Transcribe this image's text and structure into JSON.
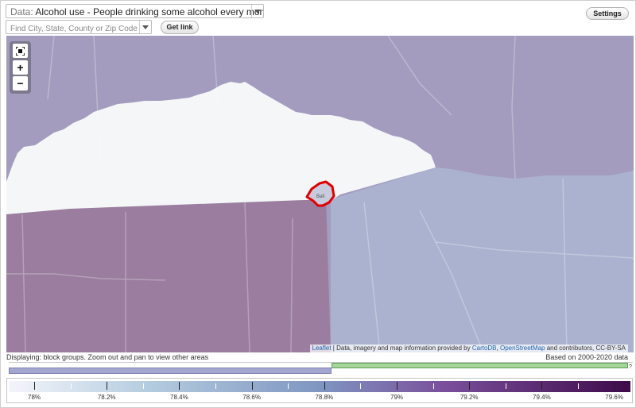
{
  "header": {
    "data_prefix": "Data:",
    "data_selected": "Alcohol use - People drinking some alcohol every month (%)",
    "search_placeholder": "Find City, State, County or Zip Code",
    "get_link_label": "Get link",
    "settings_label": "Settings"
  },
  "map": {
    "place_label": "Balt",
    "colors": {
      "white_region": "#f4f6f7",
      "purple_region": "#a39cbe",
      "plum_region": "#9a7d9f",
      "blue_region": "#aab2cf",
      "highlight_outline": "#e10000"
    },
    "zoom_controls": {
      "extent_icon": "fullscreen-extent-icon",
      "zoom_in_label": "+",
      "zoom_out_label": "−"
    },
    "attribution": {
      "leaflet": "Leaflet",
      "middle": " | Data, imagery and map information provided by ",
      "carto": "CartoDB",
      "comma": ", ",
      "osm": "OpenStreetMap",
      "tail": " and contributors, CC-BY-SA"
    }
  },
  "footer": {
    "displaying_text": "Displaying: block groups. Zoom out and pan to view other areas",
    "based_on_text": "Based on 2000-2020 data",
    "histogram_marker": "?",
    "legend_labels": [
      "78%",
      "78.2%",
      "78.4%",
      "78.6%",
      "78.8%",
      "79%",
      "79.2%",
      "79.4%",
      "79.6%"
    ]
  }
}
